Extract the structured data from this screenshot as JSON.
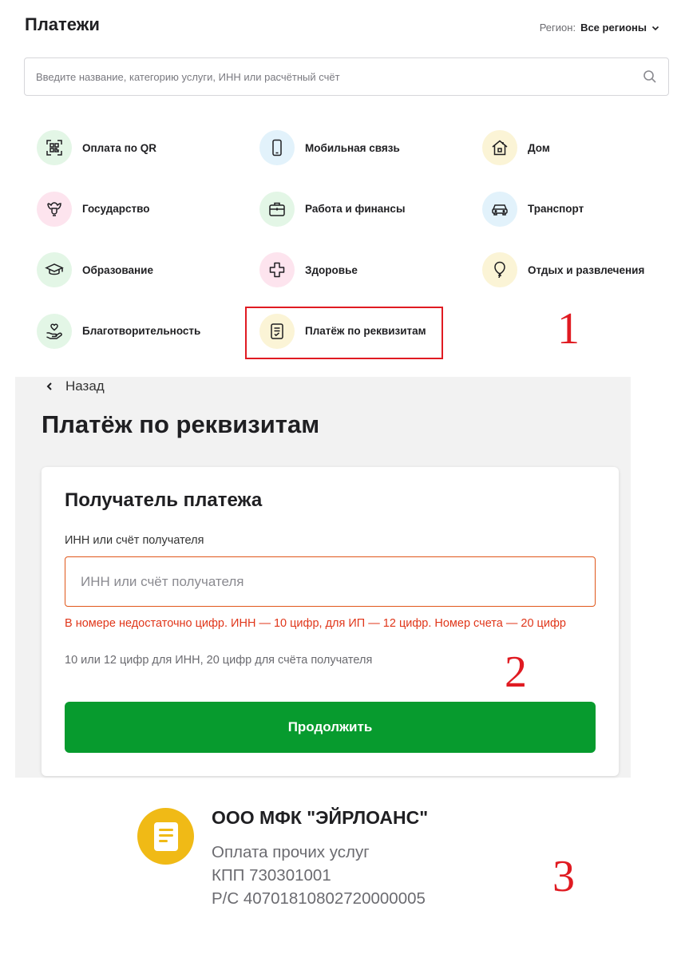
{
  "header": {
    "title": "Платежи",
    "region_label": "Регион:",
    "region_value": "Все регионы"
  },
  "search": {
    "placeholder": "Введите название, категорию услуги, ИНН или расчётный счёт"
  },
  "categories": [
    {
      "label": "Оплата по QR",
      "icon": "qr-icon",
      "color": "#e3f6e6"
    },
    {
      "label": "Мобильная связь",
      "icon": "phone-icon",
      "color": "#e2f2fb"
    },
    {
      "label": "Дом",
      "icon": "house-icon",
      "color": "#fbf4d6"
    },
    {
      "label": "Государство",
      "icon": "emblem-icon",
      "color": "#fde4ee"
    },
    {
      "label": "Работа и финансы",
      "icon": "briefcase-icon",
      "color": "#e3f6e6"
    },
    {
      "label": "Транспорт",
      "icon": "car-icon",
      "color": "#e2f2fb"
    },
    {
      "label": "Образование",
      "icon": "graduation-cap-icon",
      "color": "#e3f6e6"
    },
    {
      "label": "Здоровье",
      "icon": "medical-cross-icon",
      "color": "#fde4ee"
    },
    {
      "label": "Отдых и развлечения",
      "icon": "balloon-icon",
      "color": "#fbf4d6"
    },
    {
      "label": "Благотворительность",
      "icon": "charity-hand-icon",
      "color": "#e3f6e6"
    },
    {
      "label": "Платёж по реквизитам",
      "icon": "document-icon",
      "color": "#fbf4d6"
    }
  ],
  "markers": {
    "one": "1",
    "two": "2",
    "three": "3",
    "color": "#e01b22"
  },
  "details_form": {
    "back_label": "Назад",
    "title": "Платёж по реквизитам",
    "card_title": "Получатель платежа",
    "field_label": "ИНН или счёт получателя",
    "field_placeholder": "ИНН или счёт получателя",
    "field_value": "",
    "error_text": "В номере недостаточно цифр. ИНН — 10 цифр, для ИП — 12 цифр. Номер счета — 20 цифр",
    "hint_text": "10 или 12 цифр для ИНН, 20 цифр для счёта получателя",
    "continue_label": "Продолжить",
    "accent_color": "#079b2e",
    "error_color": "#e0361a"
  },
  "recipient": {
    "name": "ООО МФК \"ЭЙРЛОАНС\"",
    "service": "Оплата прочих услуг",
    "kpp": "КПП 730301001",
    "account": "Р/С 40701810802720000005",
    "avatar_color": "#f0ba16",
    "avatar_icon": "document-icon"
  }
}
